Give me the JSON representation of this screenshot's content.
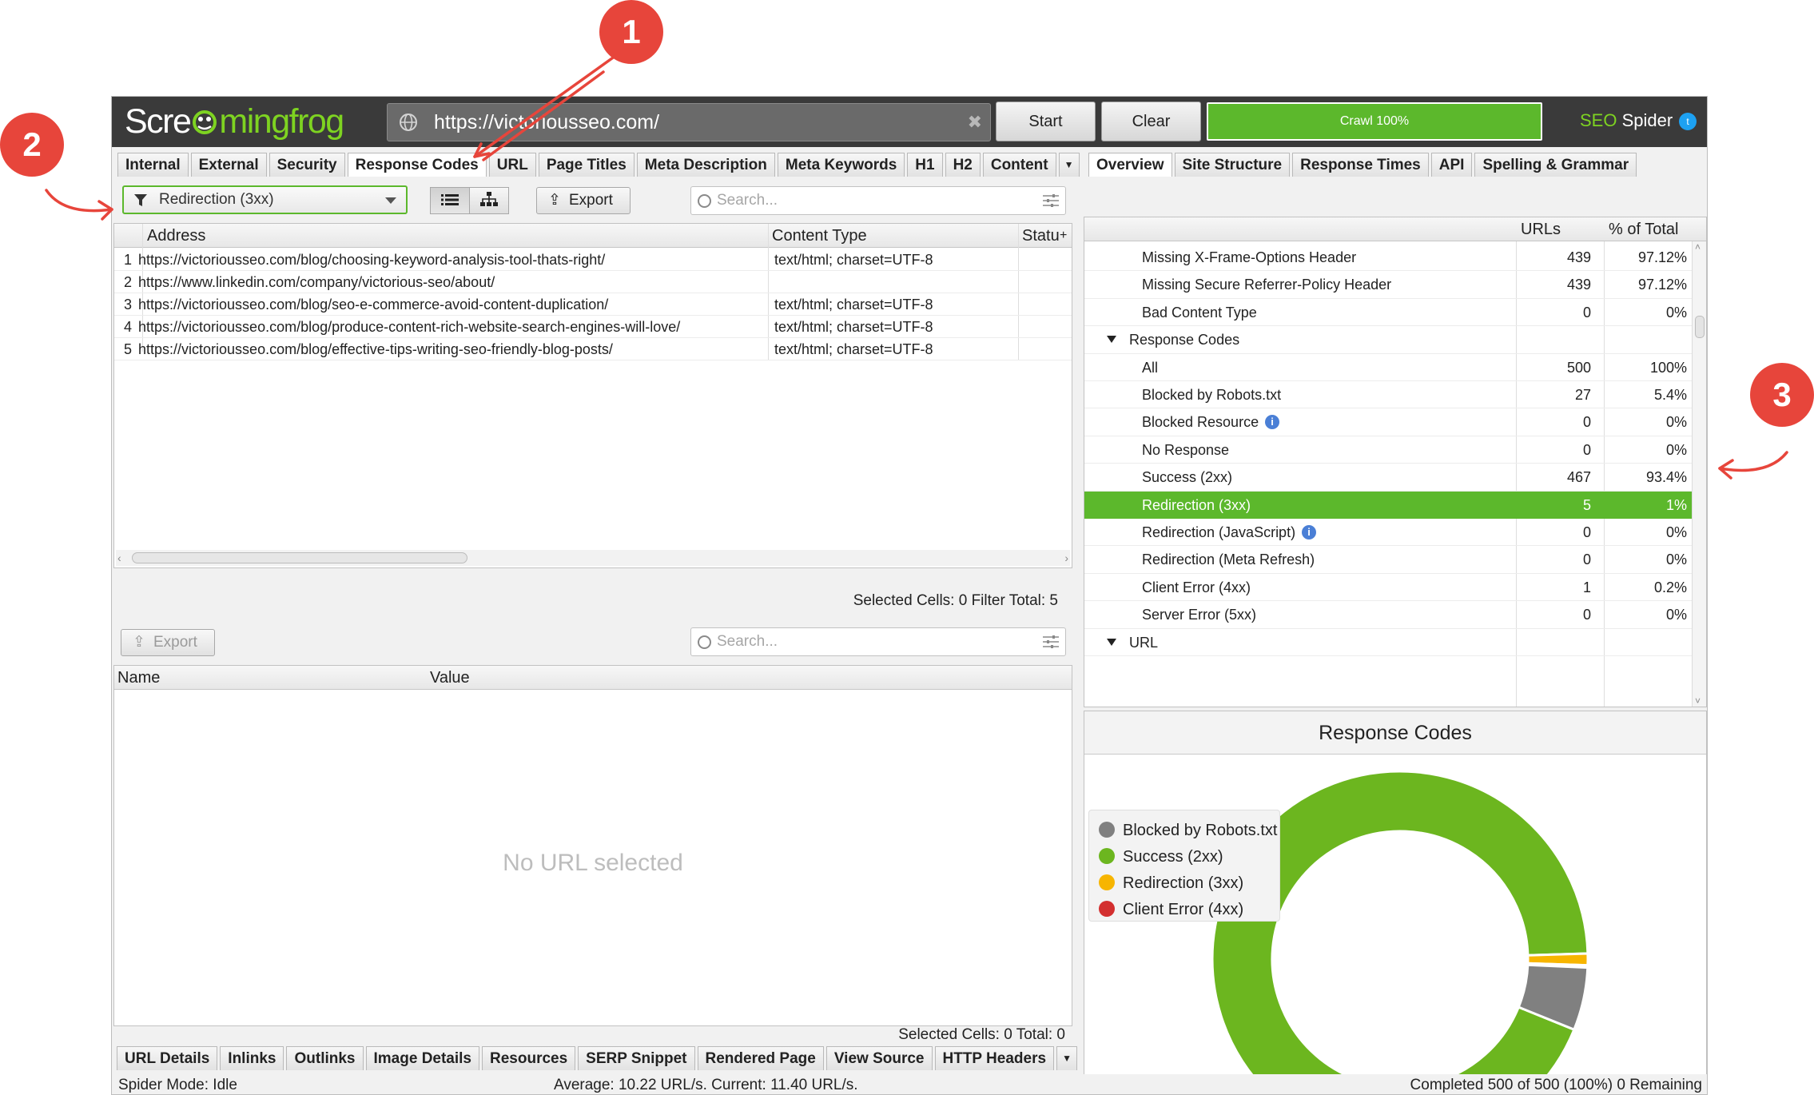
{
  "app": {
    "logo": {
      "left": "Scre",
      "right": "mingfrog"
    },
    "url": "https://victoriousseo.com/",
    "buttons": {
      "start": "Start",
      "clear": "Clear"
    },
    "crawl_progress": {
      "label": "Crawl 100%",
      "value": 100
    },
    "product": {
      "prefix": "SEO",
      "suffix": " Spider"
    }
  },
  "left_tabs": [
    "Internal",
    "External",
    "Security",
    "Response Codes",
    "URL",
    "Page Titles",
    "Meta Description",
    "Meta Keywords",
    "H1",
    "H2",
    "Content"
  ],
  "left_tabs_active": "Response Codes",
  "filter": {
    "selected": "Redirection (3xx)"
  },
  "toolbar": {
    "export": "Export",
    "search_placeholder": "Search..."
  },
  "main_table": {
    "columns": [
      "Address",
      "Content Type",
      "Statu"
    ],
    "rows": [
      {
        "n": "1",
        "address": "https://victoriousseo.com/blog/choosing-keyword-analysis-tool-thats-right/",
        "content_type": "text/html; charset=UTF-8"
      },
      {
        "n": "2",
        "address": "https://www.linkedin.com/company/victorious-seo/about/",
        "content_type": ""
      },
      {
        "n": "3",
        "address": "https://victoriousseo.com/blog/seo-e-commerce-avoid-content-duplication/",
        "content_type": "text/html; charset=UTF-8"
      },
      {
        "n": "4",
        "address": "https://victoriousseo.com/blog/produce-content-rich-website-search-engines-will-love/",
        "content_type": "text/html; charset=UTF-8"
      },
      {
        "n": "5",
        "address": "https://victoriousseo.com/blog/effective-tips-writing-seo-friendly-blog-posts/",
        "content_type": "text/html; charset=UTF-8"
      }
    ],
    "status": "Selected Cells:  0  Filter Total:  5"
  },
  "details": {
    "export": "Export",
    "search_placeholder": "Search...",
    "columns": [
      "Name",
      "Value"
    ],
    "empty": "No URL selected",
    "status": "Selected Cells:  0  Total:  0"
  },
  "bottom_tabs": [
    "URL Details",
    "Inlinks",
    "Outlinks",
    "Image Details",
    "Resources",
    "SERP Snippet",
    "Rendered Page",
    "View Source",
    "HTTP Headers"
  ],
  "right_tabs": [
    "Overview",
    "Site Structure",
    "Response Times",
    "API",
    "Spelling & Grammar"
  ],
  "right_tabs_active": "Overview",
  "overview": {
    "columns": [
      "URLs",
      "% of Total"
    ],
    "rows": [
      {
        "label": "Missing X-Frame-Options Header",
        "urls": "439",
        "pct": "97.12%",
        "level": 2
      },
      {
        "label": "Missing Secure Referrer-Policy Header",
        "urls": "439",
        "pct": "97.12%",
        "level": 2
      },
      {
        "label": "Bad Content Type",
        "urls": "0",
        "pct": "0%",
        "level": 2
      },
      {
        "label": "Response Codes",
        "urls": "",
        "pct": "",
        "level": 1
      },
      {
        "label": "All",
        "urls": "500",
        "pct": "100%",
        "level": 2
      },
      {
        "label": "Blocked by Robots.txt",
        "urls": "27",
        "pct": "5.4%",
        "level": 2
      },
      {
        "label": "Blocked Resource",
        "urls": "0",
        "pct": "0%",
        "level": 2,
        "info": true
      },
      {
        "label": "No Response",
        "urls": "0",
        "pct": "0%",
        "level": 2
      },
      {
        "label": "Success (2xx)",
        "urls": "467",
        "pct": "93.4%",
        "level": 2
      },
      {
        "label": "Redirection (3xx)",
        "urls": "5",
        "pct": "1%",
        "level": 2,
        "selected": true
      },
      {
        "label": "Redirection (JavaScript)",
        "urls": "0",
        "pct": "0%",
        "level": 2,
        "info": true
      },
      {
        "label": "Redirection (Meta Refresh)",
        "urls": "0",
        "pct": "0%",
        "level": 2
      },
      {
        "label": "Client Error (4xx)",
        "urls": "1",
        "pct": "0.2%",
        "level": 2
      },
      {
        "label": "Server Error (5xx)",
        "urls": "0",
        "pct": "0%",
        "level": 2
      },
      {
        "label": "URL",
        "urls": "",
        "pct": "",
        "level": 1
      }
    ]
  },
  "chart_data": {
    "type": "pie",
    "title": "Response Codes",
    "series": [
      {
        "name": "Blocked by Robots.txt",
        "value": 27,
        "color": "#808080"
      },
      {
        "name": "Success (2xx)",
        "value": 467,
        "color": "#6cb61f"
      },
      {
        "name": "Redirection (3xx)",
        "value": 5,
        "color": "#f7b500"
      },
      {
        "name": "Client Error (4xx)",
        "value": 1,
        "color": "#d32f2f"
      }
    ],
    "legend_position": "left"
  },
  "statusbar": {
    "mode": "Spider Mode: Idle",
    "rate": "Average: 10.22 URL/s. Current: 11.40 URL/s.",
    "completed": "Completed 500 of 500 (100%) 0 Remaining"
  },
  "annotations": [
    "1",
    "2",
    "3"
  ],
  "colors": {
    "accent": "#5cb82c",
    "badge": "#e7453b"
  }
}
